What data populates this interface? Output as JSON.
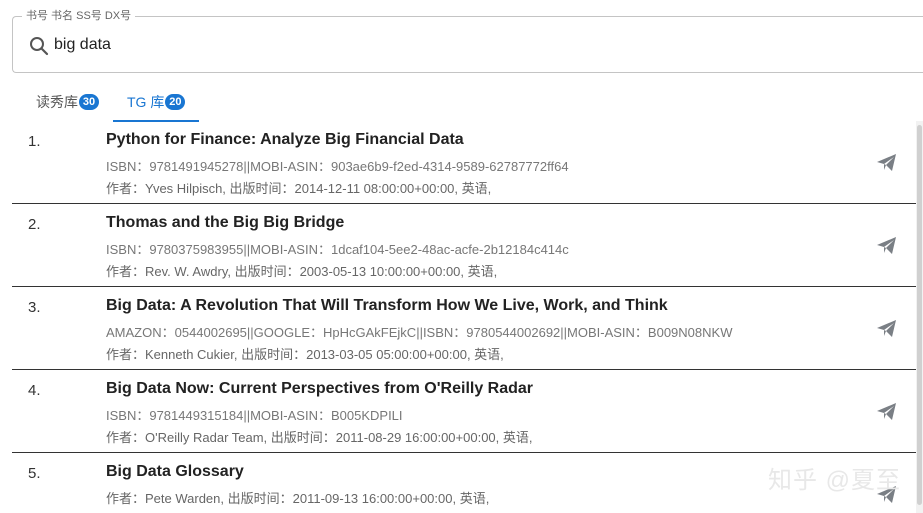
{
  "search": {
    "legend": "书号 书名 SS号 DX号",
    "value": "big data",
    "icon": "search-icon"
  },
  "tabs": [
    {
      "label": "读秀库",
      "count": "30",
      "active": false
    },
    {
      "label": "TG 库",
      "count": "20",
      "active": true
    }
  ],
  "results": [
    {
      "num": "1.",
      "title": "Python for Finance: Analyze Big Financial Data",
      "ids": "ISBN：9781491945278||MOBI-ASIN：903ae6b9-f2ed-4314-9589-62787772ff64",
      "meta": "作者：Yves Hilpisch, 出版时间：2014-12-11 08:00:00+00:00, 英语,"
    },
    {
      "num": "2.",
      "title": "Thomas and the Big Big Bridge",
      "ids": "ISBN：9780375983955||MOBI-ASIN：1dcaf104-5ee2-48ac-acfe-2b12184c414c",
      "meta": "作者：Rev. W. Awdry, 出版时间：2003-05-13 10:00:00+00:00, 英语,"
    },
    {
      "num": "3.",
      "title": "Big Data: A Revolution That Will Transform How We Live, Work, and Think",
      "ids": "AMAZON：0544002695||GOOGLE：HpHcGAkFEjkC||ISBN：9780544002692||MOBI-ASIN：B009N08NKW",
      "meta": "作者：Kenneth Cukier, 出版时间：2013-03-05 05:00:00+00:00, 英语,"
    },
    {
      "num": "4.",
      "title": "Big Data Now: Current Perspectives from O'Reilly Radar",
      "ids": "ISBN：9781449315184||MOBI-ASIN：B005KDPILI",
      "meta": "作者：O'Reilly Radar Team, 出版时间：2011-08-29 16:00:00+00:00, 英语,"
    },
    {
      "num": "5.",
      "title": "Big Data Glossary",
      "ids": "",
      "meta": "作者：Pete Warden, 出版时间：2011-09-13 16:00:00+00:00, 英语,"
    }
  ],
  "watermark": "知乎 @夏至",
  "colors": {
    "accent": "#1976d2",
    "send_icon": "#7a7f85"
  }
}
